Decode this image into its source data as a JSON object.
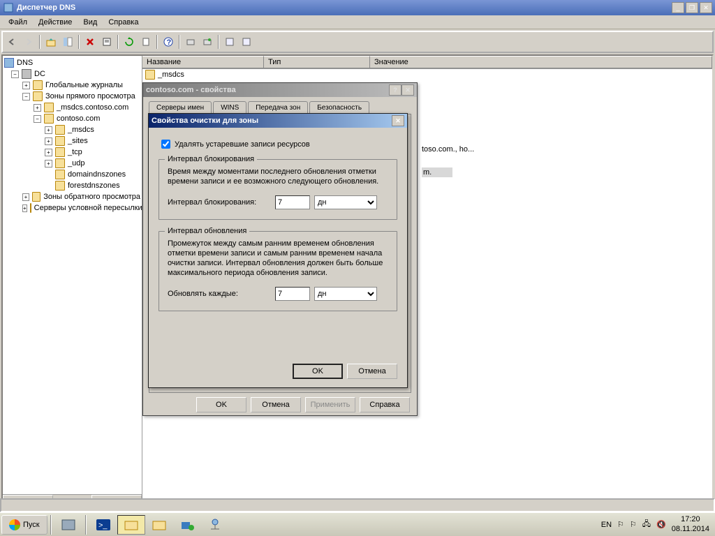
{
  "window": {
    "title": "Диспетчер DNS"
  },
  "menu": {
    "file": "Файл",
    "action": "Действие",
    "view": "Вид",
    "help": "Справка"
  },
  "tree": {
    "root": "DNS",
    "server": "DC",
    "globalLogs": "Глобальные журналы",
    "forwardZones": "Зоны прямого просмотра",
    "zone_msdcs": "_msdcs.contoso.com",
    "zone_contoso": "contoso.com",
    "sub_msdcs": "_msdcs",
    "sub_sites": "_sites",
    "sub_tcp": "_tcp",
    "sub_udp": "_udp",
    "sub_ddz": "domaindnszones",
    "sub_fdz": "forestdnszones",
    "reverseZones": "Зоны обратного просмотра",
    "condForwarders": "Серверы условной пересылки"
  },
  "list": {
    "col_name": "Название",
    "col_type": "Тип",
    "col_value": "Значение",
    "row0": "_msdcs",
    "partial1": "toso.com., ho...",
    "partial2": "m."
  },
  "props": {
    "title": "contoso.com - свойства",
    "tab1": "Серверы имен",
    "tab2": "WINS",
    "tab3": "Передача зон",
    "tab4": "Безопасность",
    "ok": "OK",
    "cancel": "Отмена",
    "apply": "Применить",
    "help": "Справка"
  },
  "scav": {
    "title": "Свойства очистки для зоны",
    "checkbox": "Удалять устаревшие записи ресурсов",
    "group1_title": "Интервал блокирования",
    "group1_desc": "Время между моментами последнего обновления отметки времени записи и ее возможного следующего обновления.",
    "group1_label": "Интервал блокирования:",
    "group1_value": "7",
    "group1_unit": "дн",
    "group2_title": "Интервал обновления",
    "group2_desc": "Промежуток между самым ранним временем обновления отметки времени записи и самым ранним временем начала очистки записи. Интервал обновления должен быть больше максимального периода обновления записи.",
    "group2_label": "Обновлять каждые:",
    "group2_value": "7",
    "group2_unit": "дн",
    "ok": "OK",
    "cancel": "Отмена"
  },
  "taskbar": {
    "start": "Пуск",
    "lang": "EN",
    "time": "17:20",
    "date": "08.11.2014"
  }
}
